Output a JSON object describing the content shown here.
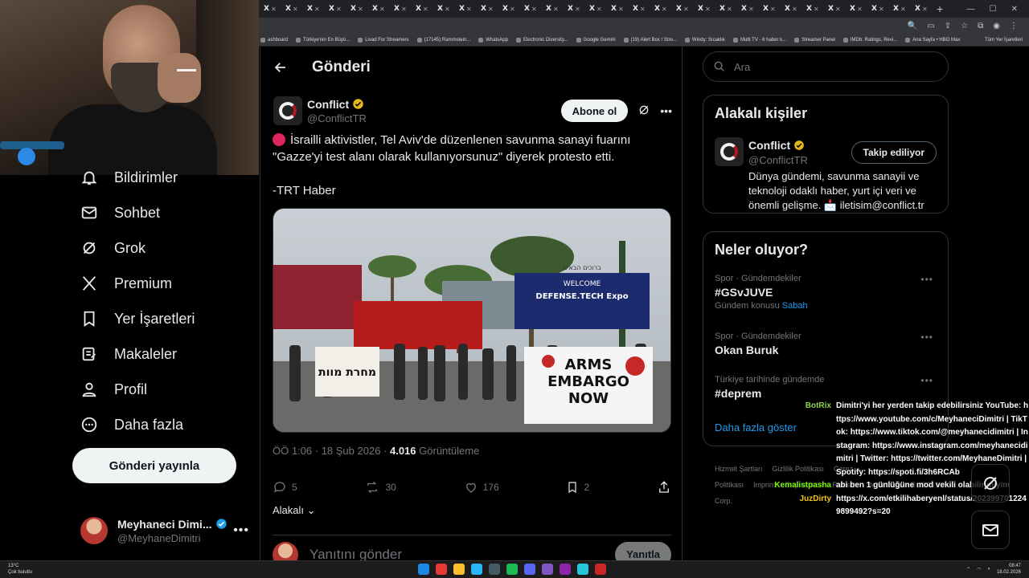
{
  "browser": {
    "tab_label": "X",
    "tab_count": 31,
    "bookmarks": [
      "ashboard",
      "Türkiye'nin En Büyü...",
      "Livad For Streamers",
      "(17145) Rammstein...",
      "WhatsApp",
      "Electronic Diversity...",
      "Google Gemini",
      "(19) Alert Box / Stre...",
      "Windy: Sıcaklık",
      "Multi TV - 6 haber k...",
      "Streamer Panel",
      "IMDb: Ratings, Revi...",
      "Ana Sayfa • HBO Max"
    ],
    "all_bookmarks": "Tüm Yer İşaretleri"
  },
  "nav": {
    "items": [
      {
        "label": "Bildirimler",
        "icon": "bell-icon"
      },
      {
        "label": "Sohbet",
        "icon": "mail-icon"
      },
      {
        "label": "Grok",
        "icon": "grok-icon"
      },
      {
        "label": "Premium",
        "icon": "x-logo-icon"
      },
      {
        "label": "Yer İşaretleri",
        "icon": "bookmark-icon"
      },
      {
        "label": "Makaleler",
        "icon": "article-icon"
      },
      {
        "label": "Profil",
        "icon": "person-icon"
      },
      {
        "label": "Daha fazla",
        "icon": "more-circle-icon"
      }
    ],
    "post_button": "Gönderi yayınla",
    "account": {
      "name": "Meyhaneci Dimi...",
      "handle": "@MeyhaneDimitri"
    }
  },
  "post": {
    "header_title": "Gönderi",
    "author": {
      "name": "Conflict",
      "handle": "@ConflictTR"
    },
    "subscribe_label": "Abone ol",
    "text_line1": "İsrailli aktivistler, Tel Aviv'de düzenlenen savunma sanayi fuarını \"Gazze'yi test alanı olarak kullanıyorsunuz\" diyerek protesto etti.",
    "text_line2": "-TRT Haber",
    "image": {
      "banner_hebrew": "ברוכים הבאים",
      "banner_title": "DEFENSE.TECH Expo",
      "banner_welcome": "WELCOME",
      "sign_left": "מחרת מוות",
      "sign_main_1": "ARMS",
      "sign_main_2": "EMBARGO",
      "sign_main_3": "NOW"
    },
    "time": "ÖÖ 1:06 · 18 Şub 2026 · ",
    "views": "4.016",
    "views_label": " Görüntüleme",
    "replies": "5",
    "reposts": "30",
    "likes": "176",
    "bookmarks": "2",
    "related_label": "Alakalı",
    "reply_placeholder": "Yanıtını gönder",
    "reply_button": "Yanıtla"
  },
  "sidebar": {
    "search_placeholder": "Ara",
    "related": {
      "title": "Alakalı kişiler",
      "name": "Conflict",
      "handle": "@ConflictTR",
      "follow_label": "Takip ediliyor",
      "bio": "Dünya gündemi, savunma sanayii ve teknoloji odaklı haber, yurt içi veri ve önemli gelişme. 📩 iletisim@conflict.tr"
    },
    "trends": {
      "title": "Neler oluyor?",
      "items": [
        {
          "context": "Spor · Gündemdekiler",
          "title": "#GSvJUVE",
          "extra_prefix": "Gündem konusu ",
          "extra_link": "Sabah"
        },
        {
          "context": "Spor · Gündemdekiler",
          "title": "Okan Buruk"
        },
        {
          "context": "Türkiye tarihinde gündemde",
          "title": "#deprem"
        }
      ],
      "show_more": "Daha fazla göster"
    },
    "footer": [
      "Hizmet Şartları",
      "Gizlilik Politikası",
      "Çerez Politikası",
      "Imprint",
      "Erişilebilirlik",
      "Reklam",
      "Daha fazla",
      "© 2026 X Corp."
    ]
  },
  "chat": [
    {
      "user": "BotRix",
      "text": "Dimitri'yi her yerden takip edebilirsiniz YouTube: https://www.youtube.com/c/MeyhaneciDimitri | TikTok: https://www.tiktok.com/@meyhanecidimitri | Instagram: https://www.instagram.com/meyhanecidimitri | Twitter: https://twitter.com/MeyhaneDimitri | Spotify: https://spoti.fi/3h6RCAb"
    },
    {
      "user": "Kemalistpasha",
      "text": "abi ben 1 günlüğüne mod vekili olabilir miyim"
    },
    {
      "user": "JuzDirty",
      "text": "https://x.com/etkilihaberyenl/status/2023997012249899492?s=20"
    }
  ],
  "taskbar": {
    "weather_temp": "13°C",
    "weather_desc": "Çok bulutlu",
    "time": "08:47",
    "date": "18.02.2026"
  }
}
